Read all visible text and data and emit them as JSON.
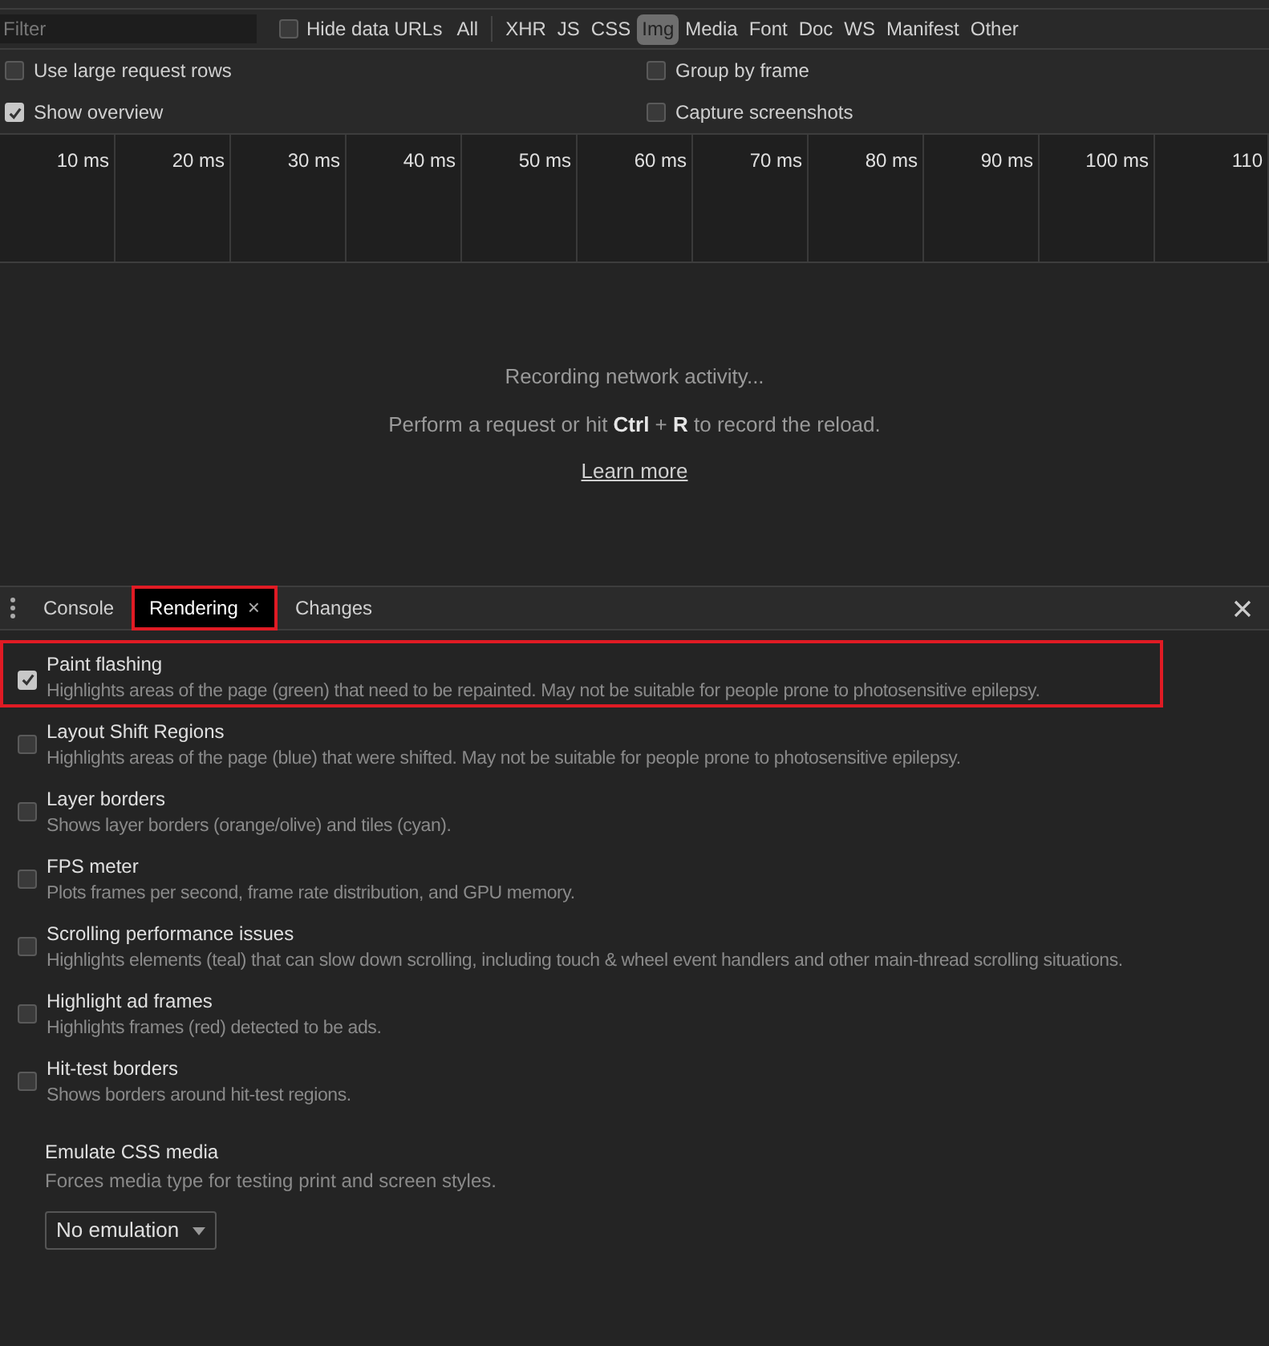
{
  "filter_bar": {
    "placeholder": "Filter",
    "hide_data_urls": {
      "label": "Hide data URLs",
      "checked": false
    },
    "types": [
      {
        "label": "All",
        "selected": false
      },
      {
        "label": "XHR",
        "selected": false
      },
      {
        "label": "JS",
        "selected": false
      },
      {
        "label": "CSS",
        "selected": false
      },
      {
        "label": "Img",
        "selected": true
      },
      {
        "label": "Media",
        "selected": false
      },
      {
        "label": "Font",
        "selected": false
      },
      {
        "label": "Doc",
        "selected": false
      },
      {
        "label": "WS",
        "selected": false
      },
      {
        "label": "Manifest",
        "selected": false
      },
      {
        "label": "Other",
        "selected": false
      }
    ]
  },
  "settings": [
    {
      "label": "Use large request rows",
      "checked": false
    },
    {
      "label": "Group by frame",
      "checked": false
    },
    {
      "label": "Show overview",
      "checked": true
    },
    {
      "label": "Capture screenshots",
      "checked": false
    }
  ],
  "timeline": {
    "ticks": [
      "10 ms",
      "20 ms",
      "30 ms",
      "40 ms",
      "50 ms",
      "60 ms",
      "70 ms",
      "80 ms",
      "90 ms",
      "100 ms",
      "110"
    ]
  },
  "empty_state": {
    "title": "Recording network activity...",
    "hint": "Perform a request or hit **Ctrl** + **R** to record the reload.",
    "link": "Learn more"
  },
  "drawer": {
    "tabs": [
      {
        "label": "Console",
        "selected": false,
        "highlighted": false
      },
      {
        "label": "Rendering",
        "selected": true,
        "close": "×",
        "highlighted": true
      },
      {
        "label": "Changes",
        "selected": false,
        "highlighted": false
      }
    ],
    "options": [
      {
        "title": "Paint flashing",
        "description": "Highlights areas of the page (green) that need to be repainted. May not be suitable for people prone to photosensitive epilepsy.",
        "checked": true,
        "highlighted": true
      },
      {
        "title": "Layout Shift Regions",
        "description": "Highlights areas of the page (blue) that were shifted. May not be suitable for people prone to photosensitive epilepsy.",
        "checked": false,
        "highlighted": false
      },
      {
        "title": "Layer borders",
        "description": "Shows layer borders (orange/olive) and tiles (cyan).",
        "checked": false,
        "highlighted": false
      },
      {
        "title": "FPS meter",
        "description": "Plots frames per second, frame rate distribution, and GPU memory.",
        "checked": false,
        "highlighted": false
      },
      {
        "title": "Scrolling performance issues",
        "description": "Highlights elements (teal) that can slow down scrolling, including touch & wheel event handlers and other main-thread scrolling situations.",
        "checked": false,
        "highlighted": false
      },
      {
        "title": "Highlight ad frames",
        "description": "Highlights frames (red) detected to be ads.",
        "checked": false,
        "highlighted": false
      },
      {
        "title": "Hit-test borders",
        "description": "Shows borders around hit-test regions.",
        "checked": false,
        "highlighted": false
      }
    ],
    "emulate_media": {
      "title": "Emulate CSS media",
      "description": "Forces media type for testing print and screen styles.",
      "value": "No emulation"
    }
  }
}
